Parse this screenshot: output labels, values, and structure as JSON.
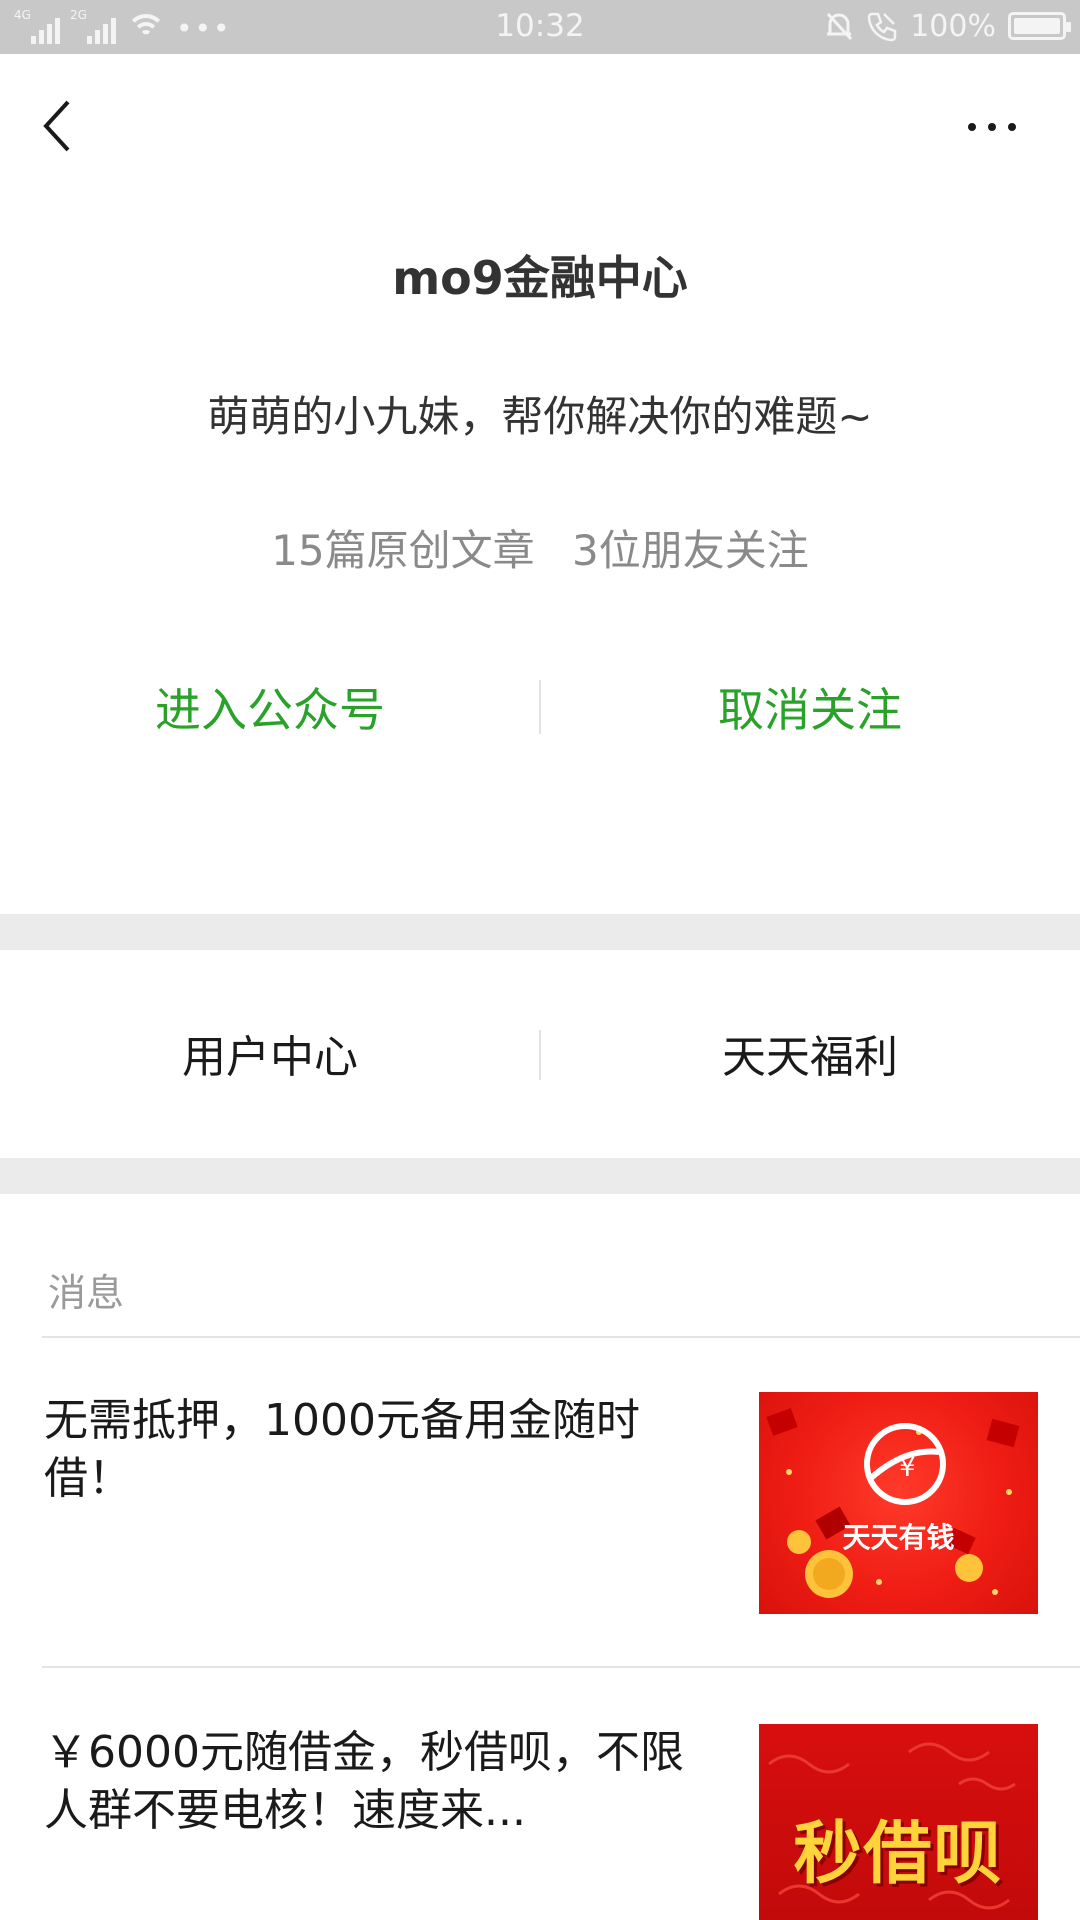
{
  "status_bar": {
    "network_1": "4G",
    "network_2": "2G",
    "time": "10:32",
    "battery": "100%",
    "battery_level": 1.0
  },
  "account": {
    "name": "mo9金融中心",
    "description": "萌萌的小九妹，帮你解决你的难题~",
    "articles": "15篇原创文章",
    "friends": "3位朋友关注"
  },
  "actions": {
    "enter": "进入公众号",
    "unfollow": "取消关注"
  },
  "menu": {
    "user_center": "用户中心",
    "daily_benefits": "天天福利"
  },
  "messages": {
    "label": "消息",
    "items": [
      {
        "title": "无需抵押，1000元备用金随时借！",
        "thumb_text": "天天有钱"
      },
      {
        "title": "￥6000元随借金，秒借呗，不限人群不要电核！速度来...",
        "thumb_text": "秒借呗"
      }
    ]
  },
  "colors": {
    "accent_green": "#2aa22a",
    "status_bar": "#c8c8c8",
    "divider": "#ebebeb"
  }
}
